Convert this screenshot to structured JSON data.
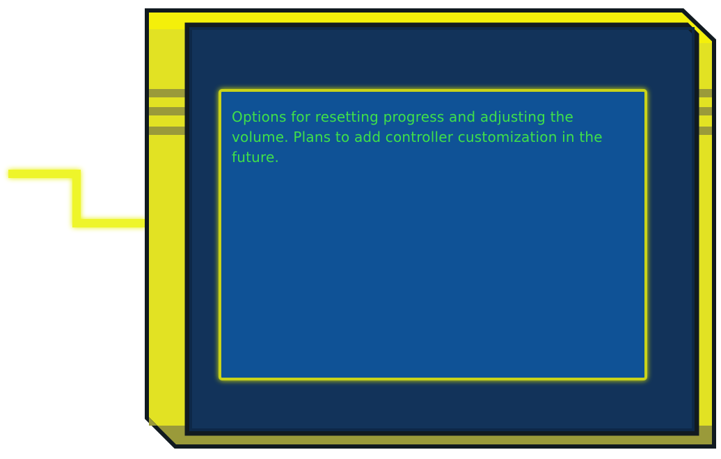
{
  "panel": {
    "description": "Options for resetting progress and adjusting the volume. Plans to add controller customization in the future."
  },
  "colors": {
    "frame_yellow": "#e2e223",
    "frame_top_yellow": "#f4f00a",
    "frame_shadow_olive": "#9a9a3a",
    "frame_outline": "#111a20",
    "panel_navy": "#12335a",
    "screen_blue": "#0f5296",
    "screen_border_glow": "#c9d31a",
    "text_green": "#3fe04a",
    "connector_yellow": "#eef52a"
  }
}
